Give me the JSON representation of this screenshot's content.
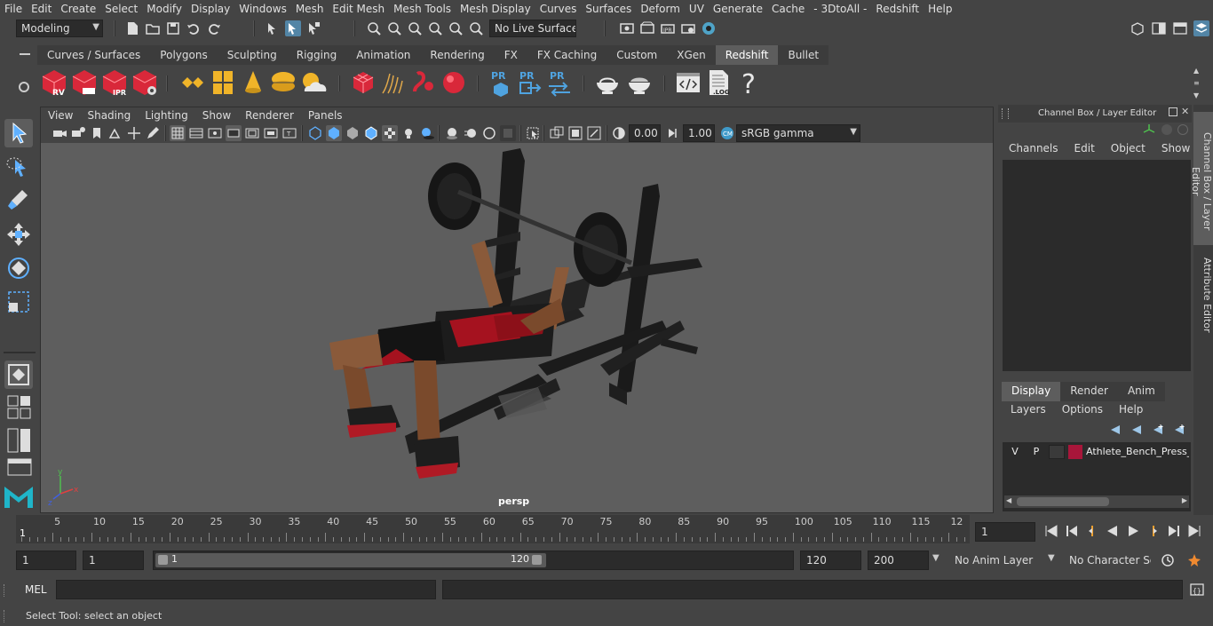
{
  "menubar": {
    "items": [
      "File",
      "Edit",
      "Create",
      "Select",
      "Modify",
      "Display",
      "Windows",
      "Mesh",
      "Edit Mesh",
      "Mesh Tools",
      "Mesh Display",
      "Curves",
      "Surfaces",
      "Deform",
      "UV",
      "Generate",
      "Cache",
      "- 3DtoAll -",
      "Redshift",
      "Help"
    ]
  },
  "statusline": {
    "mode": "Modeling",
    "live_surface": "No Live Surface"
  },
  "shelf": {
    "tabs": [
      "Curves / Surfaces",
      "Polygons",
      "Sculpting",
      "Rigging",
      "Animation",
      "Rendering",
      "FX",
      "FX Caching",
      "Custom",
      "XGen",
      "Redshift",
      "Bullet"
    ],
    "active_tab": "Redshift",
    "icon_labels": {
      "rv": "RV",
      "ipr": "IPR",
      "pr": "PR",
      "log": ".LOG",
      "help": "?"
    }
  },
  "viewport": {
    "menu": [
      "View",
      "Shading",
      "Lighting",
      "Show",
      "Renderer",
      "Panels"
    ],
    "exposure": "0.00",
    "gamma": "1.00",
    "color_space": "sRGB gamma",
    "camera_label": "persp",
    "axis": {
      "y": "y",
      "x": "x",
      "z": "z"
    }
  },
  "channelbox": {
    "title": "Channel Box / Layer Editor",
    "menu": [
      "Channels",
      "Edit",
      "Object",
      "Show"
    ]
  },
  "layers": {
    "tabs": [
      "Display",
      "Render",
      "Anim"
    ],
    "active_tab": "Display",
    "menu": [
      "Layers",
      "Options",
      "Help"
    ],
    "rows": [
      {
        "v": "V",
        "p": "P",
        "name": "Athlete_Bench_Press_S",
        "color": "#a8163a"
      }
    ]
  },
  "sidetabs": [
    "Channel Box / Layer Editor",
    "Attribute Editor"
  ],
  "timeline": {
    "ticks": [
      "5",
      "10",
      "15",
      "20",
      "25",
      "30",
      "35",
      "40",
      "45",
      "50",
      "55",
      "60",
      "65",
      "70",
      "75",
      "80",
      "85",
      "90",
      "95",
      "100",
      "105",
      "110",
      "115",
      "12"
    ],
    "current_frame_marker": "1",
    "current_frame": "1"
  },
  "range": {
    "start": "1",
    "playback_start": "1",
    "slider_start": "1",
    "slider_end": "120",
    "playback_end": "120",
    "end": "200",
    "anim_layer": "No Anim Layer",
    "character_set": "No Character Set"
  },
  "cmdline": {
    "label": "MEL"
  },
  "helpline": {
    "text": "Select Tool: select an object"
  },
  "colors": {
    "accent_red": "#d9283a",
    "active_tab": "#5d5d5d",
    "viewport_bg": "#5e5e5e",
    "highlight_blue": "#5285a6"
  }
}
